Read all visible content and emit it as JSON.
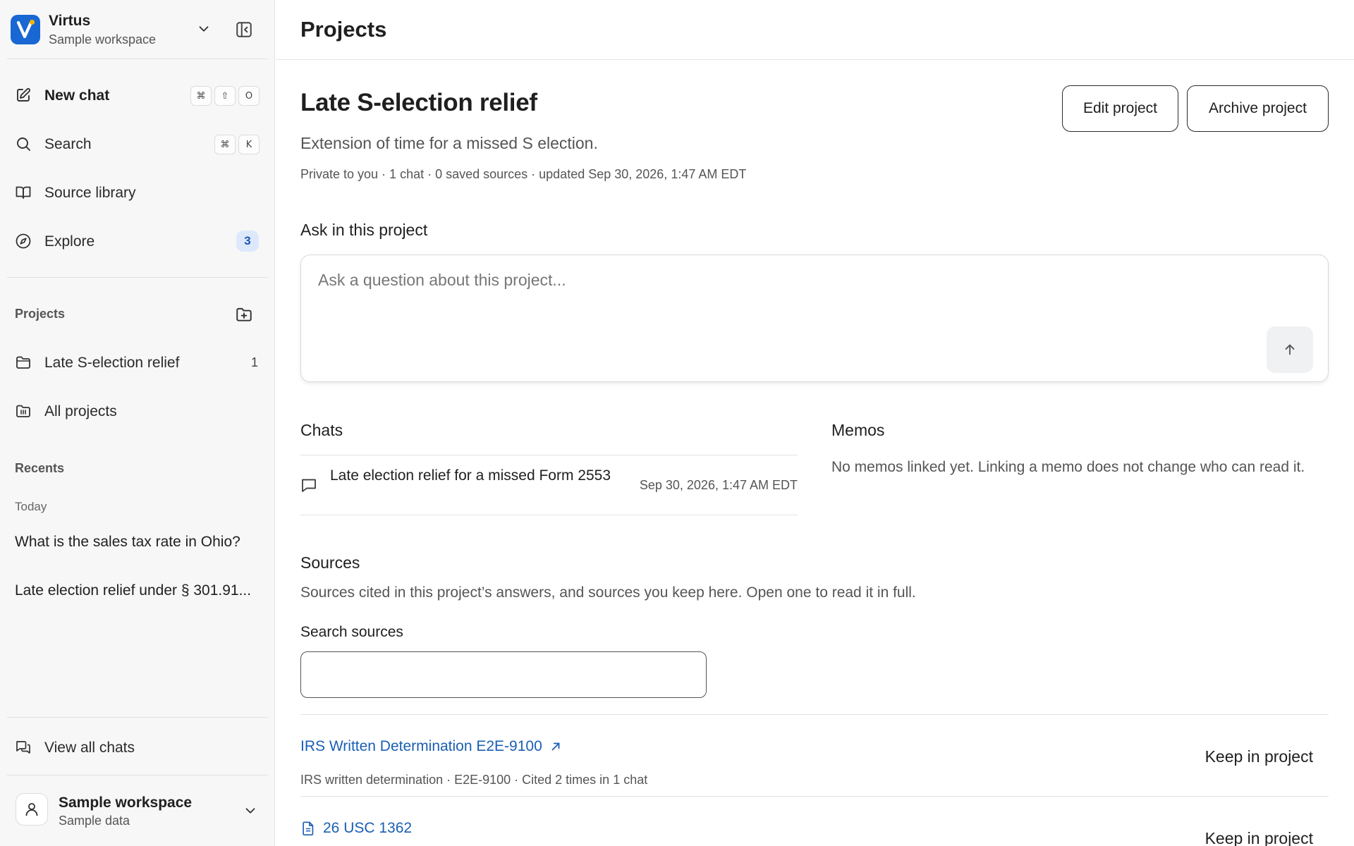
{
  "workspace": {
    "name": "Virtus",
    "subtitle": "Sample workspace",
    "logo_letter": "V",
    "brand_color": "#1967d2"
  },
  "sidebar": {
    "nav": [
      {
        "label": "New chat",
        "icon": "edit-icon",
        "shortcut": [
          "⌘",
          "⇧",
          "O"
        ]
      },
      {
        "label": "Search",
        "icon": "search-icon",
        "shortcut": [
          "⌘",
          "K"
        ]
      },
      {
        "label": "Source library",
        "icon": "book-icon"
      },
      {
        "label": "Explore",
        "icon": "compass-icon",
        "badge": "3"
      }
    ],
    "projects_heading": "Projects",
    "projects": [
      {
        "label": "Late S-election relief",
        "icon": "folder-icon",
        "count": "1"
      },
      {
        "label": "All projects",
        "icon": "folders-icon"
      }
    ],
    "recents_heading": "Recents",
    "today_heading": "Today",
    "recents": [
      "What is the sales tax rate in Ohio?",
      "Late election relief under § 301.91..."
    ],
    "view_all_chats": "View all chats",
    "user": {
      "name": "Sample workspace",
      "subtitle": "Sample data"
    }
  },
  "main": {
    "page_title": "Projects",
    "project": {
      "title": "Late S-election relief",
      "description": "Extension of time for a missed S election.",
      "meta": "Private to you · 1 chat · 0 saved sources · updated Sep 30, 2026, 1:47 AM EDT",
      "edit_label": "Edit project",
      "archive_label": "Archive project"
    },
    "ask": {
      "heading": "Ask in this project",
      "placeholder": "Ask a question about this project..."
    },
    "chats": {
      "heading": "Chats",
      "items": [
        {
          "title": "Late election relief for a missed Form 2553",
          "time": "Sep 30, 2026, 1:47 AM EDT"
        }
      ]
    },
    "memos": {
      "heading": "Memos",
      "empty_text": "No memos linked yet. Linking a memo does not change who can read it."
    },
    "sources": {
      "heading": "Sources",
      "description": "Sources cited in this project’s answers, and sources you keep here. Open one to read it in full.",
      "search_label": "Search sources",
      "search_value": "",
      "items": [
        {
          "title": "IRS Written Determination E2E-9100",
          "meta": "IRS written determination · E2E-9100 · Cited 2 times in 1 chat",
          "action": "Keep in project"
        },
        {
          "title": "26 USC 1362",
          "meta": "",
          "action": "Keep in project"
        }
      ],
      "link_color": "#1a5fb4"
    }
  }
}
